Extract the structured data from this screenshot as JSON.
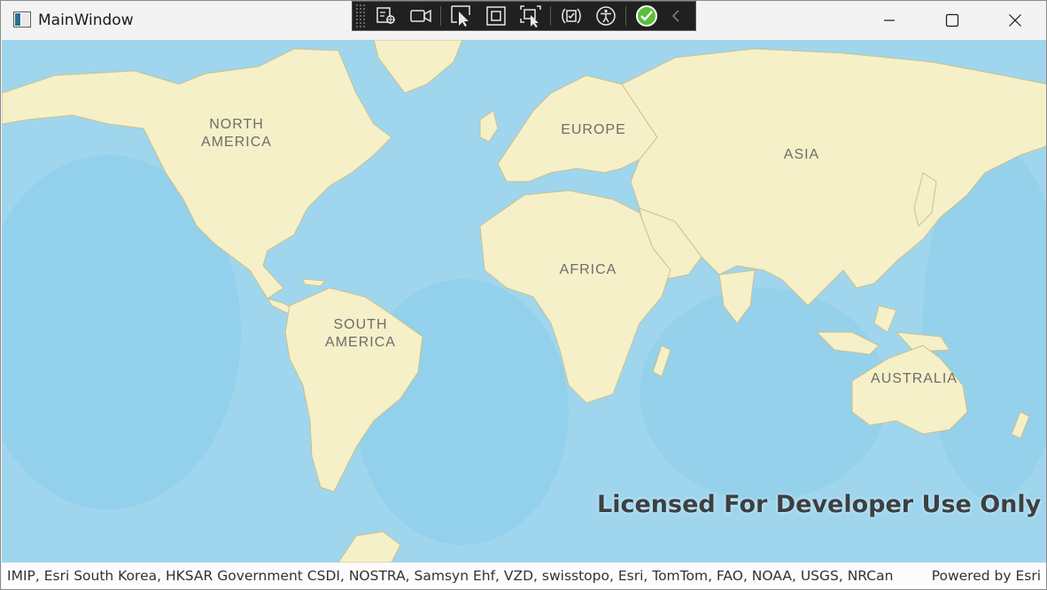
{
  "window": {
    "title": "MainWindow"
  },
  "debug_toolbar": {
    "tools": [
      {
        "name": "select-element-icon"
      },
      {
        "name": "record-icon"
      },
      {
        "name": "hover-select-icon"
      },
      {
        "name": "layout-adorner-icon"
      },
      {
        "name": "track-focus-icon"
      },
      {
        "name": "hot-reload-icon"
      },
      {
        "name": "accessibility-icon"
      },
      {
        "name": "check-status-icon"
      },
      {
        "name": "collapse-chevron-icon"
      }
    ],
    "status_color": "#5bbf3a"
  },
  "map": {
    "ocean_color": "#9fd6ee",
    "land_color": "#f5f0c8",
    "labels": {
      "north_america_1": "NORTH",
      "north_america_2": "AMERICA",
      "europe": "EUROPE",
      "asia": "ASIA",
      "africa": "AFRICA",
      "south_america_1": "SOUTH",
      "south_america_2": "AMERICA",
      "australia": "AUSTRALIA"
    },
    "watermark": "Licensed For Developer Use Only"
  },
  "attribution": {
    "text": "IMIP, Esri South Korea, HKSAR Government CSDI, NOSTRA, Samsyn Ehf, VZD, swisstopo, Esri, TomTom, FAO, NOAA, USGS, NRCan",
    "powered_by": "Powered by Esri"
  }
}
